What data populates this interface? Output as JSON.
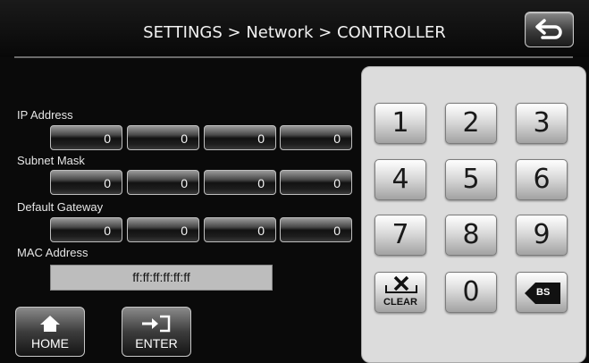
{
  "header": {
    "title": "SETTINGS > Network > CONTROLLER"
  },
  "fields": {
    "ip": {
      "label": "IP Address",
      "octets": [
        "0",
        "0",
        "0",
        "0"
      ]
    },
    "subnet": {
      "label": "Subnet Mask",
      "octets": [
        "0",
        "0",
        "0",
        "0"
      ]
    },
    "gateway": {
      "label": "Default Gateway",
      "octets": [
        "0",
        "0",
        "0",
        "0"
      ]
    },
    "mac": {
      "label": "MAC Address",
      "value": "ff:ff:ff:ff:ff:ff"
    }
  },
  "bottom": {
    "home_label": "HOME",
    "enter_label": "ENTER"
  },
  "keypad": {
    "digits": [
      "1",
      "2",
      "3",
      "4",
      "5",
      "6",
      "7",
      "8",
      "9",
      "0"
    ],
    "clear_label": "CLEAR",
    "backspace_label": "BS"
  },
  "icons": {
    "back": "back-arrow-icon",
    "home": "home-icon",
    "enter": "enter-icon",
    "clear": "x-icon",
    "backspace": "backspace-icon"
  }
}
